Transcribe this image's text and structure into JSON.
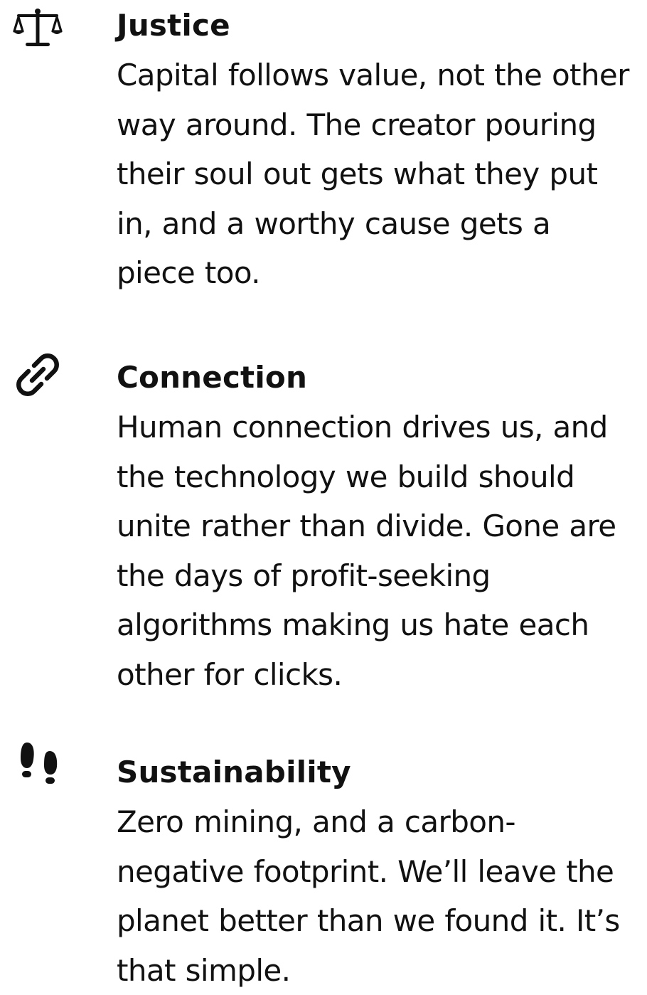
{
  "values": [
    {
      "icon": "scales-icon",
      "title": "Justice",
      "description": "Capital follows value, not the other way around. The creator pouring their soul out gets what they put in, and a worthy cause gets a piece too."
    },
    {
      "icon": "link-icon",
      "title": "Connection",
      "description": "Human connection drives us, and the technology we build should unite rather than divide. Gone are the days of profit-seeking algorithms making us hate each other for clicks."
    },
    {
      "icon": "footprints-icon",
      "title": "Sustainability",
      "description": "Zero mining, and a carbon-negative footprint. We’ll leave the planet better than we found it. It’s that simple."
    }
  ],
  "colors": {
    "text": "#111111",
    "background": "#ffffff"
  }
}
